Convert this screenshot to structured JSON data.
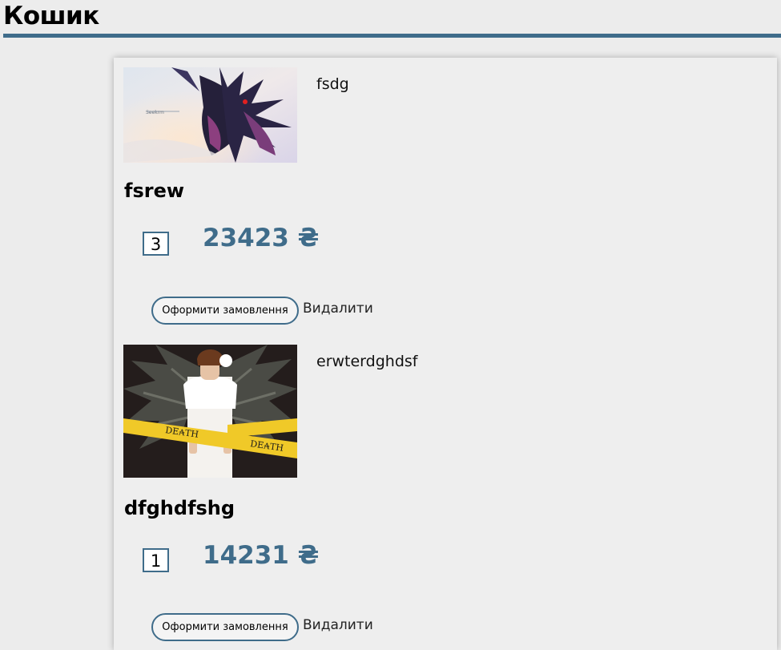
{
  "page": {
    "title": "Кошик"
  },
  "cart": {
    "items": [
      {
        "description": "fsdg",
        "title": "fsrew",
        "quantity": "3",
        "price": "23423 ₴",
        "order_label": "Оформити замовлення",
        "remove_label": "Видалити"
      },
      {
        "description": "erwterdghdsf",
        "title": "dfghdfshg",
        "quantity": "1",
        "price": "14231 ₴",
        "order_label": "Оформити замовлення",
        "remove_label": "Видалити"
      }
    ]
  },
  "colors": {
    "accent": "#3f6c8a",
    "background": "#ececec",
    "panel": "#eeeeee"
  }
}
